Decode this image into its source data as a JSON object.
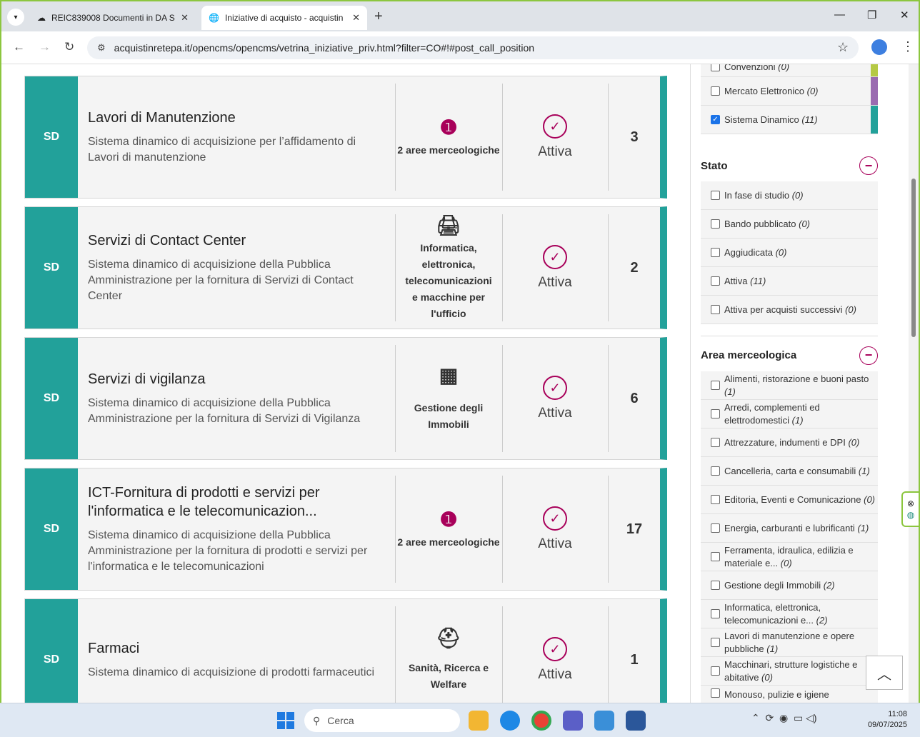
{
  "browser": {
    "tabs": [
      {
        "title": "REIC839008 Documenti in DA S",
        "active": false
      },
      {
        "title": "Iniziative di acquisto - acquistin",
        "active": true
      }
    ],
    "url": "acquistinretepa.it/opencms/opencms/vetrina_iniziative_priv.html?filter=CO#!#post_call_position"
  },
  "cards": [
    {
      "badge": "SD",
      "title": "Lavori di Manutenzione",
      "desc": "Sistema dinamico di acquisizione per l’affidamento di Lavori di manutenzione",
      "area": "2 aree merceologiche",
      "area_icon": "info-icon",
      "stato": "Attiva",
      "count": "3"
    },
    {
      "badge": "SD",
      "title": "Servizi di Contact Center",
      "desc": "Sistema dinamico di acquisizione della Pubblica Amministrazione per la fornitura di Servizi di Contact Center",
      "area": "Informatica, elettronica, telecomunicazioni e macchine per l'ufficio",
      "area_icon": "printer-icon",
      "stato": "Attiva",
      "count": "2"
    },
    {
      "badge": "SD",
      "title": "Servizi di vigilanza",
      "desc": "Sistema dinamico di acquisizione della Pubblica Amministrazione per la fornitura di Servizi di Vigilanza",
      "area": "Gestione degli Immobili",
      "area_icon": "building-icon",
      "stato": "Attiva",
      "count": "6"
    },
    {
      "badge": "SD",
      "title": "ICT-Fornitura di prodotti e servizi per l'informatica e le telecomunicazion...",
      "desc": "Sistema dinamico di acquisizione della Pubblica Amministrazione per la fornitura di prodotti e servizi per l'informatica e le telecomunicazioni",
      "area": "2 aree merceologiche",
      "area_icon": "info-icon",
      "stato": "Attiva",
      "count": "17"
    },
    {
      "badge": "SD",
      "title": "Farmaci",
      "desc": "Sistema dinamico di acquisizione di prodotti farmaceutici",
      "area": "Sanità, Ricerca e Welfare",
      "area_icon": "medical-kit-icon",
      "stato": "Attiva",
      "count": "1"
    }
  ],
  "sidebar": {
    "strumento": [
      {
        "label": "Convenzioni",
        "count": "(0)",
        "checked": false
      },
      {
        "label": "Mercato Elettronico",
        "count": "(0)",
        "checked": false
      },
      {
        "label": "Sistema Dinamico",
        "count": "(11)",
        "checked": true
      }
    ],
    "stato_title": "Stato",
    "stato": [
      {
        "label": "In fase di studio",
        "count": "(0)"
      },
      {
        "label": "Bando pubblicato",
        "count": "(0)"
      },
      {
        "label": "Aggiudicata",
        "count": "(0)"
      },
      {
        "label": "Attiva",
        "count": "(11)"
      },
      {
        "label": "Attiva per acquisti successivi",
        "count": "(0)"
      }
    ],
    "area_title": "Area merceologica",
    "area": [
      {
        "label": "Alimenti, ristorazione e buoni pasto",
        "count": "(1)"
      },
      {
        "label": "Arredi, complementi ed elettrodomestici",
        "count": "(1)"
      },
      {
        "label": "Attrezzature, indumenti e DPI",
        "count": "(0)"
      },
      {
        "label": "Cancelleria, carta e consumabili",
        "count": "(1)"
      },
      {
        "label": "Editoria, Eventi e Comunicazione",
        "count": "(0)"
      },
      {
        "label": "Energia, carburanti e lubrificanti",
        "count": "(1)"
      },
      {
        "label": "Ferramenta, idraulica, edilizia e materiale e...",
        "count": "(0)"
      },
      {
        "label": "Gestione degli Immobili",
        "count": "(2)"
      },
      {
        "label": "Informatica, elettronica, telecomunicazioni e...",
        "count": "(2)"
      },
      {
        "label": "Lavori di manutenzione e opere pubbliche",
        "count": "(1)"
      },
      {
        "label": "Macchinari, strutture logistiche e abitative",
        "count": "(0)"
      },
      {
        "label": "Monouso, pulizie e igiene",
        "count": ""
      }
    ]
  },
  "taskbar": {
    "search": "Cerca",
    "time": "11:08",
    "date": "09/07/2025"
  },
  "colors": {
    "accent_teal": "#22a19a",
    "accent_magenta": "#a8005a",
    "frame_green": "#8cc63f"
  }
}
